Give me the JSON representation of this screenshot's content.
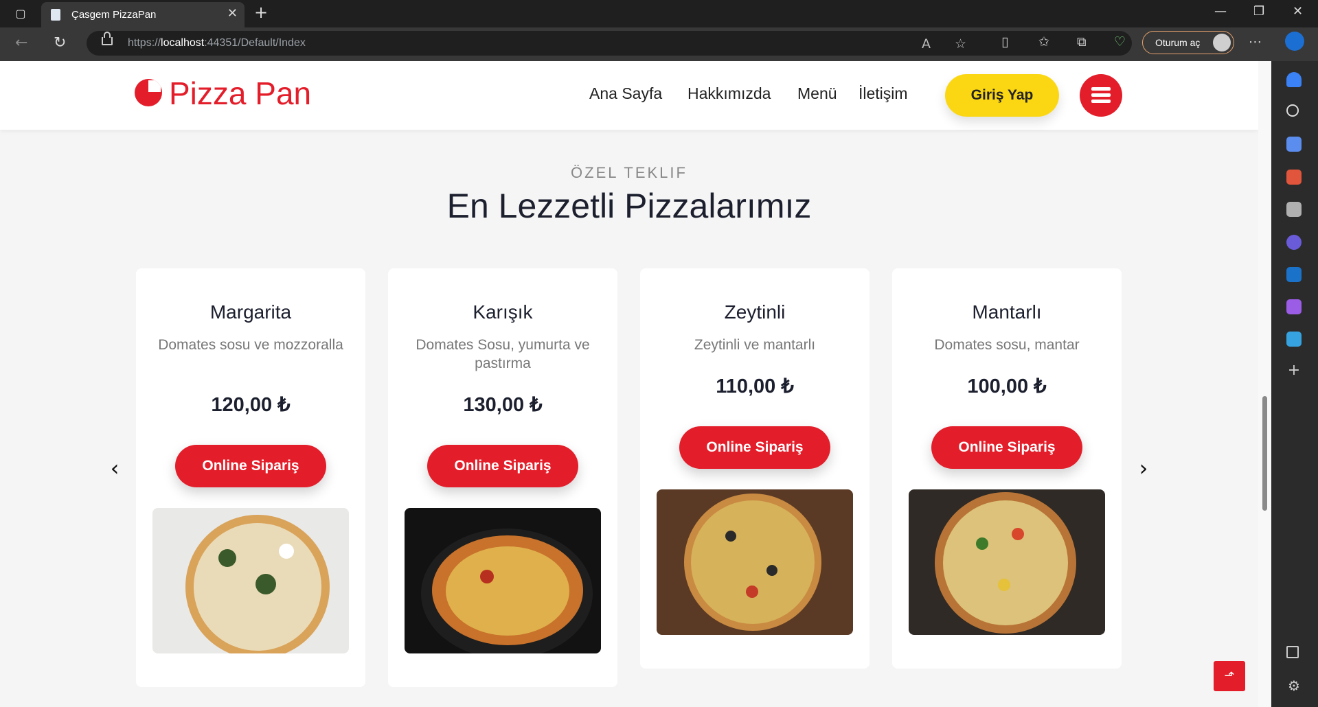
{
  "browser": {
    "tab_title": "Çasgem PizzaPan",
    "url_prefix": "https://",
    "url_host": "localhost",
    "url_rest": ":44351/Default/Index",
    "signin_label": "Oturum aç"
  },
  "site": {
    "logo_text": "Pizza Pan",
    "menu": [
      "Ana Sayfa",
      "Hakkımızda",
      "Menü",
      "İletişim"
    ],
    "login_label": "Giriş Yap",
    "accent": "#e31e2a",
    "button_yellow": "#fbd713"
  },
  "section": {
    "subtitle": "ÖZEL TEKLIF",
    "title": "En Lezzetli Pizzalarımız"
  },
  "products": [
    {
      "name": "Margarita",
      "description": "Domates sosu ve mozzoralla",
      "price": "120,00 ₺",
      "order_label": "Online Sipariş"
    },
    {
      "name": "Karışık",
      "description": "Domates Sosu, yumurta ve pastırma",
      "price": "130,00 ₺",
      "order_label": "Online Sipariş"
    },
    {
      "name": "Zeytinli",
      "description": "Zeytinli ve mantarlı",
      "price": "110,00 ₺",
      "order_label": "Online Sipariş"
    },
    {
      "name": "Mantarlı",
      "description": "Domates sosu, mantar",
      "price": "100,00 ₺",
      "order_label": "Online Sipariş"
    }
  ],
  "icons": {
    "prev": "‹",
    "next": "›",
    "scroll_top": "⬏"
  }
}
